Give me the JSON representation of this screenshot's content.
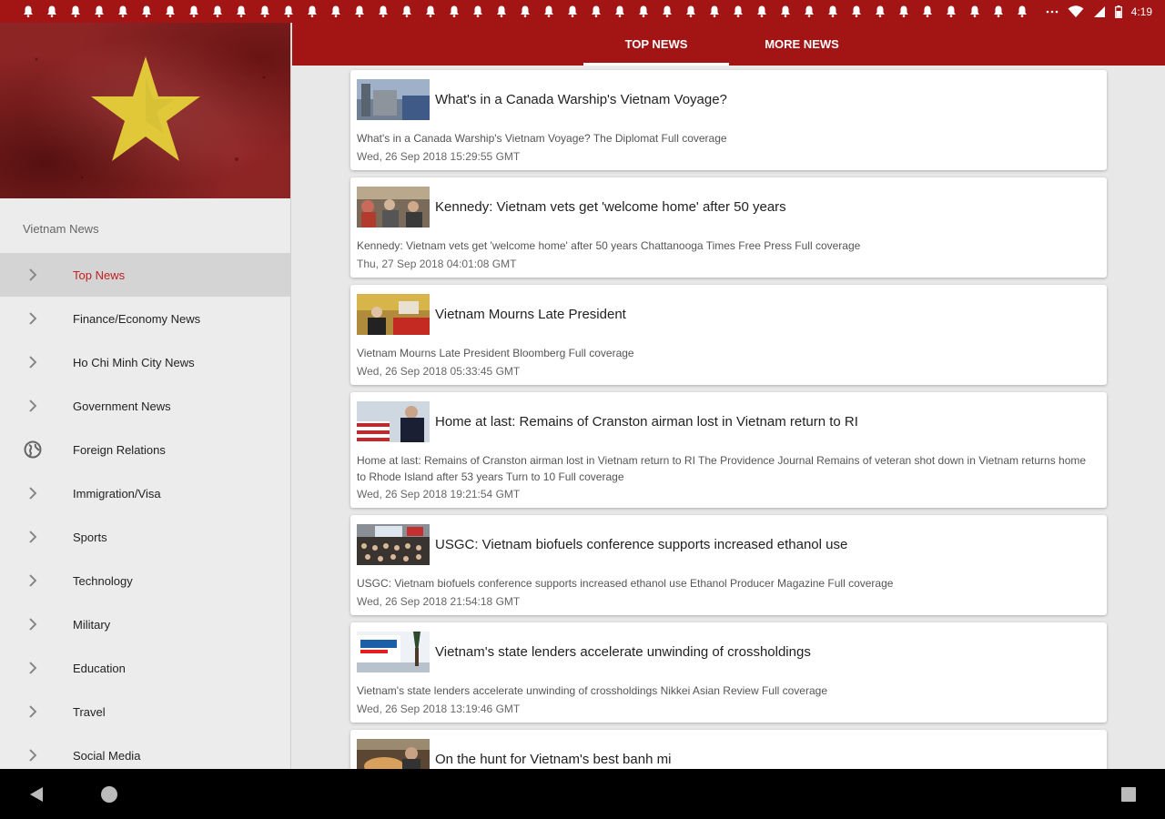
{
  "status_bar": {
    "time": "4:19",
    "notification_icon": "bell-icon",
    "notification_count": 43
  },
  "drawer": {
    "heading": "Vietnam News",
    "items": [
      {
        "label": "Top News",
        "icon": "chevron-right-icon",
        "active": true
      },
      {
        "label": "Finance/Economy News",
        "icon": "chevron-right-icon"
      },
      {
        "label": "Ho Chi Minh City News",
        "icon": "chevron-right-icon"
      },
      {
        "label": "Government News",
        "icon": "chevron-right-icon"
      },
      {
        "label": "Foreign Relations",
        "icon": "globe-icon"
      },
      {
        "label": "Immigration/Visa",
        "icon": "chevron-right-icon"
      },
      {
        "label": "Sports",
        "icon": "chevron-right-icon"
      },
      {
        "label": "Technology",
        "icon": "chevron-right-icon"
      },
      {
        "label": "Military",
        "icon": "chevron-right-icon"
      },
      {
        "label": "Education",
        "icon": "chevron-right-icon"
      },
      {
        "label": "Travel",
        "icon": "chevron-right-icon"
      },
      {
        "label": "Social Media",
        "icon": "chevron-right-icon"
      }
    ]
  },
  "tabs": [
    {
      "label": "TOP NEWS",
      "active": true
    },
    {
      "label": "MORE NEWS",
      "active": false
    }
  ],
  "articles": [
    {
      "title": "What's in a Canada Warship's Vietnam Voyage?",
      "desc": "What's in a Canada Warship's Vietnam Voyage?  The Diplomat  Full coverage",
      "date": "Wed, 26 Sep 2018 15:29:55 GMT"
    },
    {
      "title": "Kennedy: Vietnam vets get 'welcome home' after 50 years",
      "desc": "Kennedy: Vietnam vets get 'welcome home' after 50 years  Chattanooga Times Free Press  Full coverage",
      "date": "Thu, 27 Sep 2018 04:01:08 GMT"
    },
    {
      "title": "Vietnam Mourns Late President",
      "desc": "Vietnam Mourns Late President  Bloomberg  Full coverage",
      "date": "Wed, 26 Sep 2018 05:33:45 GMT"
    },
    {
      "title": "Home at last: Remains of Cranston airman lost in Vietnam return to RI",
      "desc": "Home at last: Remains of Cranston airman lost in Vietnam return to RI  The Providence Journal  Remains of veteran shot down in Vietnam returns home to Rhode Island after 53 years  Turn to 10  Full coverage",
      "date": "Wed, 26 Sep 2018 19:21:54 GMT"
    },
    {
      "title": "USGC: Vietnam biofuels conference supports increased ethanol use",
      "desc": "USGC: Vietnam biofuels conference supports increased ethanol use  Ethanol Producer Magazine  Full coverage",
      "date": "Wed, 26 Sep 2018 21:54:18 GMT"
    },
    {
      "title": "Vietnam's state lenders accelerate unwinding of crossholdings",
      "desc": "Vietnam's state lenders accelerate unwinding of crossholdings  Nikkei Asian Review  Full coverage",
      "date": "Wed, 26 Sep 2018 13:19:46 GMT"
    },
    {
      "title": "On the hunt for Vietnam's best banh mi",
      "desc": "",
      "date": ""
    }
  ],
  "colors": {
    "primary": "#a31515",
    "active_text": "#c0201f",
    "flag_star": "#e6d13a"
  }
}
